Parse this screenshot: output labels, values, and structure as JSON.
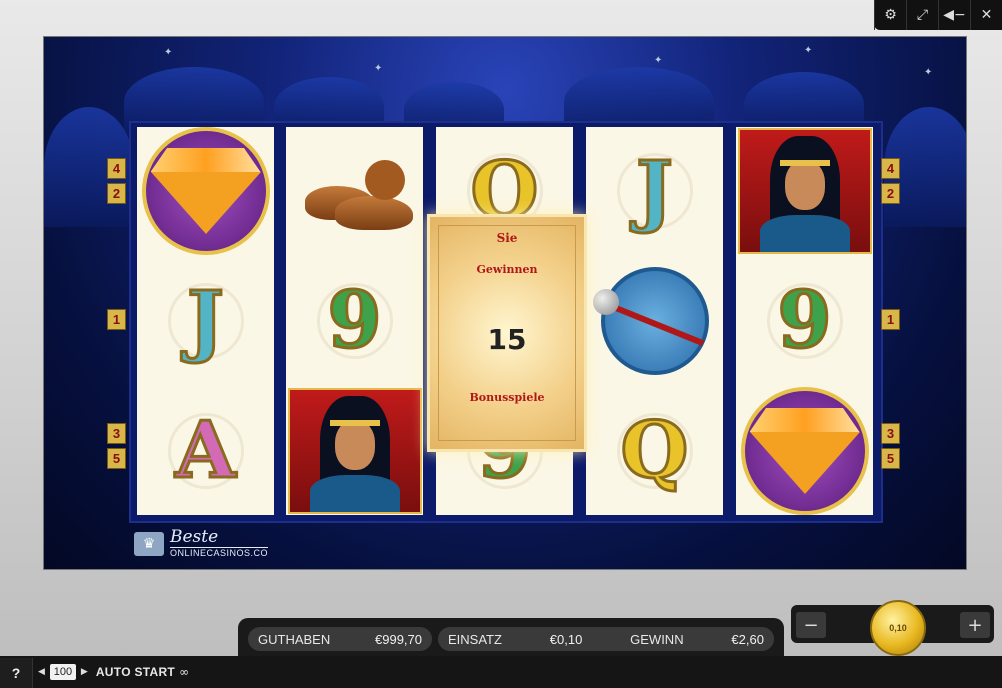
{
  "toolbar": {
    "settings_icon": "gear-icon",
    "fullscreen_icon": "fullscreen-icon",
    "sound_icon": "speaker-icon",
    "close_icon": "close-icon"
  },
  "reels": [
    {
      "symbols": [
        "diamond",
        "J",
        "A"
      ]
    },
    {
      "symbols": [
        "magic-shoes",
        "9",
        "princess"
      ]
    },
    {
      "symbols": [
        "Q",
        "",
        "9"
      ]
    },
    {
      "symbols": [
        "J",
        "gong",
        "Q"
      ]
    },
    {
      "symbols": [
        "princess",
        "9",
        "diamond"
      ]
    }
  ],
  "paylines": {
    "left": [
      "4",
      "2",
      "1",
      "3",
      "5"
    ],
    "right": [
      "4",
      "2",
      "1",
      "3",
      "5"
    ]
  },
  "win_popup": {
    "line1": "Sie",
    "line2": "Gewinnen",
    "count": "15",
    "line3": "Bonusspiele"
  },
  "logo": {
    "brand": "Beste",
    "sub": "ONLINECASINOS.CO"
  },
  "bottom_bar": {
    "help": "?",
    "autostart_count": "100",
    "autostart_label": "AUTO START",
    "infinity": "∞"
  },
  "info": {
    "balance_label": "GUTHABEN",
    "balance_value": "€999,70",
    "bet_label": "EINSATZ",
    "bet_value": "€0,10",
    "win_label": "GEWINN",
    "win_value": "€2,60"
  },
  "bet_control": {
    "minus": "−",
    "plus": "+",
    "coin_value": "0,10"
  },
  "colors": {
    "accent_gold": "#e8b820",
    "bg_dark": "#151515"
  }
}
